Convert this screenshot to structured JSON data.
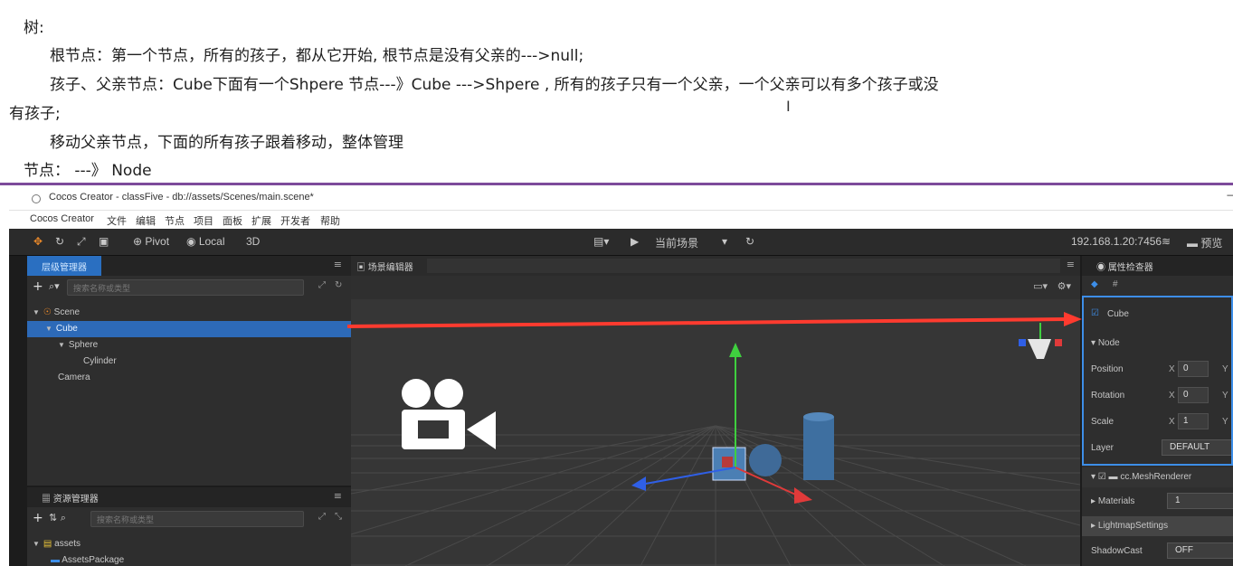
{
  "notes": {
    "line1": "树:",
    "line2": "根节点：第一个节点，所有的孩子，都从它开始, 根节点是没有父亲的--->null;",
    "line3": "孩子、父亲节点：Cube下面有一个Shpere 节点---》Cube --->Shpere , 所有的孩子只有一个父亲，一个父亲可以有多个孩子或没",
    "line4": "有孩子;",
    "line5": "移动父亲节点，下面的所有孩子跟着移动，整体管理",
    "line6": "节点：  ---》  Node"
  },
  "window": {
    "title": "Cocos Creator - classFive - db://assets/Scenes/main.scene*",
    "close_glyph": "−"
  },
  "menubar": {
    "items": [
      "Cocos Creator",
      "文件",
      "编辑",
      "节点",
      "项目",
      "面板",
      "扩展",
      "开发者",
      "帮助"
    ]
  },
  "toolbar": {
    "pivot": "Pivot",
    "local": "Local",
    "mode3d": "3D",
    "play_target": "当前场景",
    "ip": "192.168.1.20:7456",
    "preview": "预览",
    "accent": "#e8882a"
  },
  "hierarchy": {
    "tab": "层级管理器",
    "search_placeholder": "搜索名称或类型",
    "items": [
      "Scene",
      "Cube",
      "Sphere",
      "Cylinder",
      "Camera"
    ]
  },
  "scene": {
    "tab": "场景编辑器"
  },
  "inspector": {
    "tab": "属性检查器",
    "node_name": "Cube",
    "section": "Node",
    "position_label": "Position",
    "rotation_label": "Rotation",
    "scale_label": "Scale",
    "layer_label": "Layer",
    "axis_x": "X",
    "axis_y": "Y",
    "position_x": "0",
    "rotation_x": "0",
    "scale_x": "1",
    "layer_value": "DEFAULT",
    "component": "cc.MeshRenderer",
    "materials_label": "Materials",
    "materials_value": "1",
    "lightmap_label": "LightmapSettings",
    "shadow_label": "ShadowCast",
    "shadow_value": "OFF"
  },
  "assets": {
    "tab": "资源管理器",
    "search_placeholder": "搜索名称或类型",
    "items": [
      "assets",
      "AssetsPackage"
    ]
  }
}
